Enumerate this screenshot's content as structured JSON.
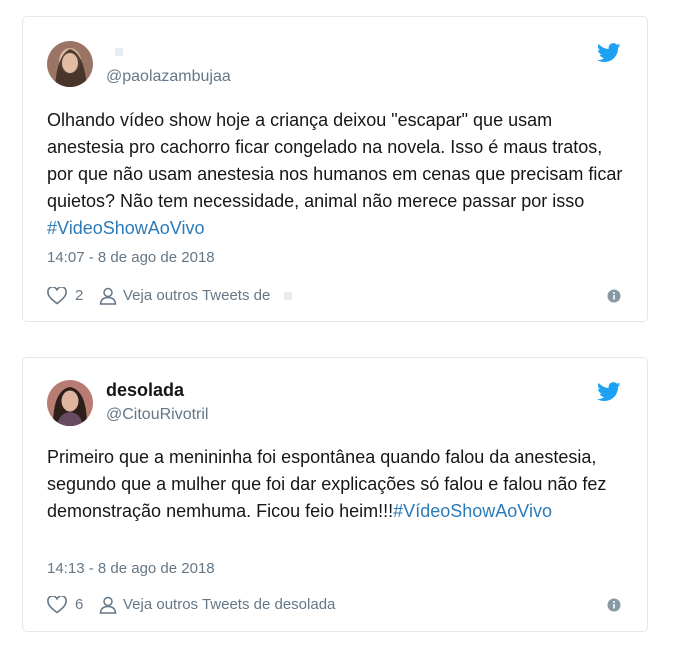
{
  "tweets": [
    {
      "name": "",
      "handle": "@paolazambujaa",
      "text": "Olhando vídeo show hoje a criança deixou \"escapar\" que usam anestesia pro cachorro ficar congelado na novela. Isso é maus tratos, por que não usam anestesia nos humanos em cenas que precisam ficar quietos? Não tem necessidade, animal não merece passar por isso ",
      "hashtag": "#VideoShowAoVivo",
      "time": "14:07 - 8 de ago de 2018",
      "likes": "2",
      "more_label": "Veja outros Tweets de",
      "more_name": ""
    },
    {
      "name": "desolada",
      "handle": "@CitouRivotril",
      "text": "Primeiro que a menininha foi espontânea quando falou da anestesia, segundo que a mulher que foi dar explicações só falou e falou não fez demonstração nemhuma. Ficou feio heim!!!",
      "hashtag": "#VídeoShowAoVivo",
      "time": "14:13 - 8 de ago de 2018",
      "likes": "6",
      "more_label": "Veja outros Tweets de",
      "more_name": "desolada"
    }
  ],
  "colors": {
    "link": "#2b7bb9",
    "bird": "#1da1f2",
    "muted": "#657786",
    "border": "#e1e8ed"
  },
  "icons": [
    "twitter-bird-icon",
    "heart-icon",
    "person-icon",
    "info-icon"
  ]
}
